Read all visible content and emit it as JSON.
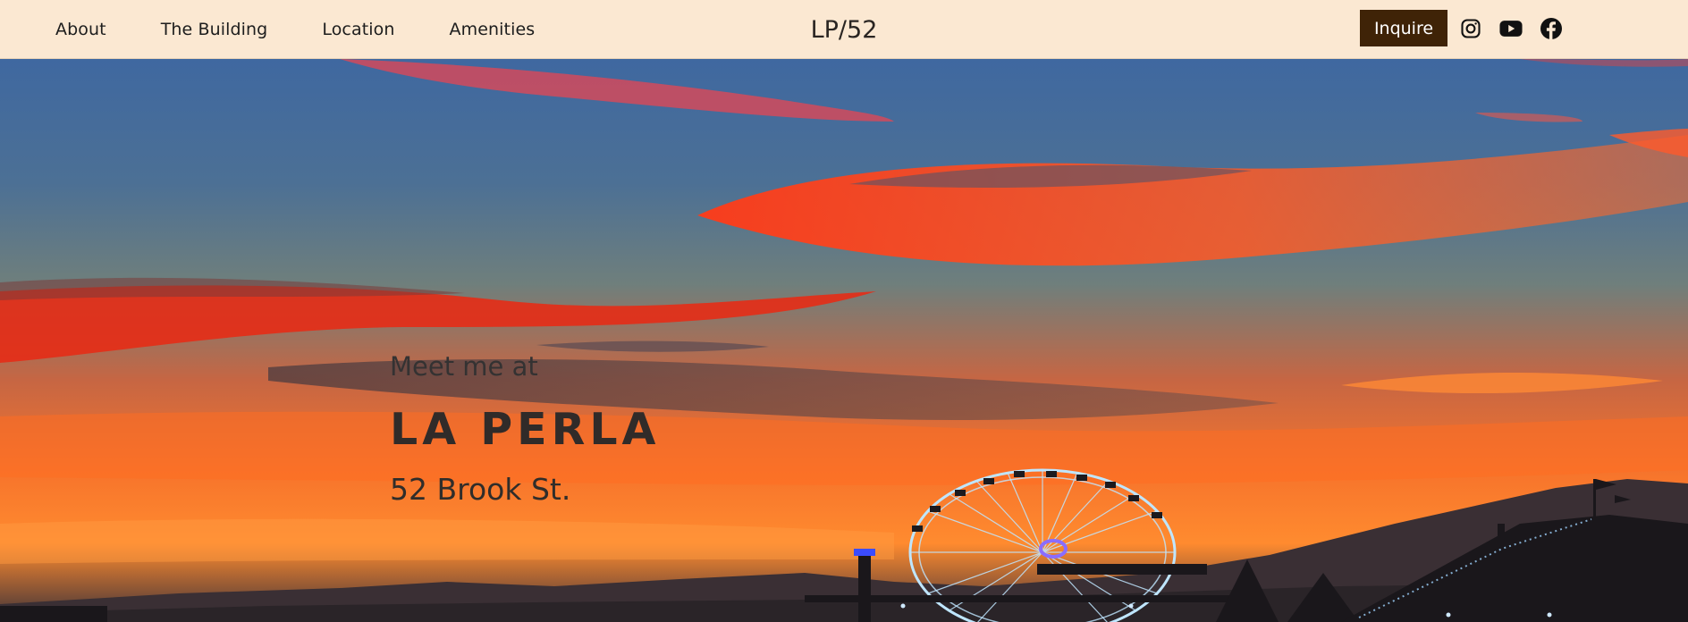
{
  "nav": {
    "links": [
      "About",
      "The Building",
      "Location",
      "Amenities"
    ],
    "brand": "LP/52",
    "inquire_label": "Inquire",
    "social_icons": [
      "instagram-icon",
      "youtube-icon",
      "facebook-icon"
    ]
  },
  "hero": {
    "tagline": "Meet me at",
    "title": "LA PERLA",
    "address": "52 Brook St."
  },
  "colors": {
    "nav_bg": "#fbe8d2",
    "inquire_bg": "#3f2307",
    "text_dark": "#1d1d1d"
  }
}
